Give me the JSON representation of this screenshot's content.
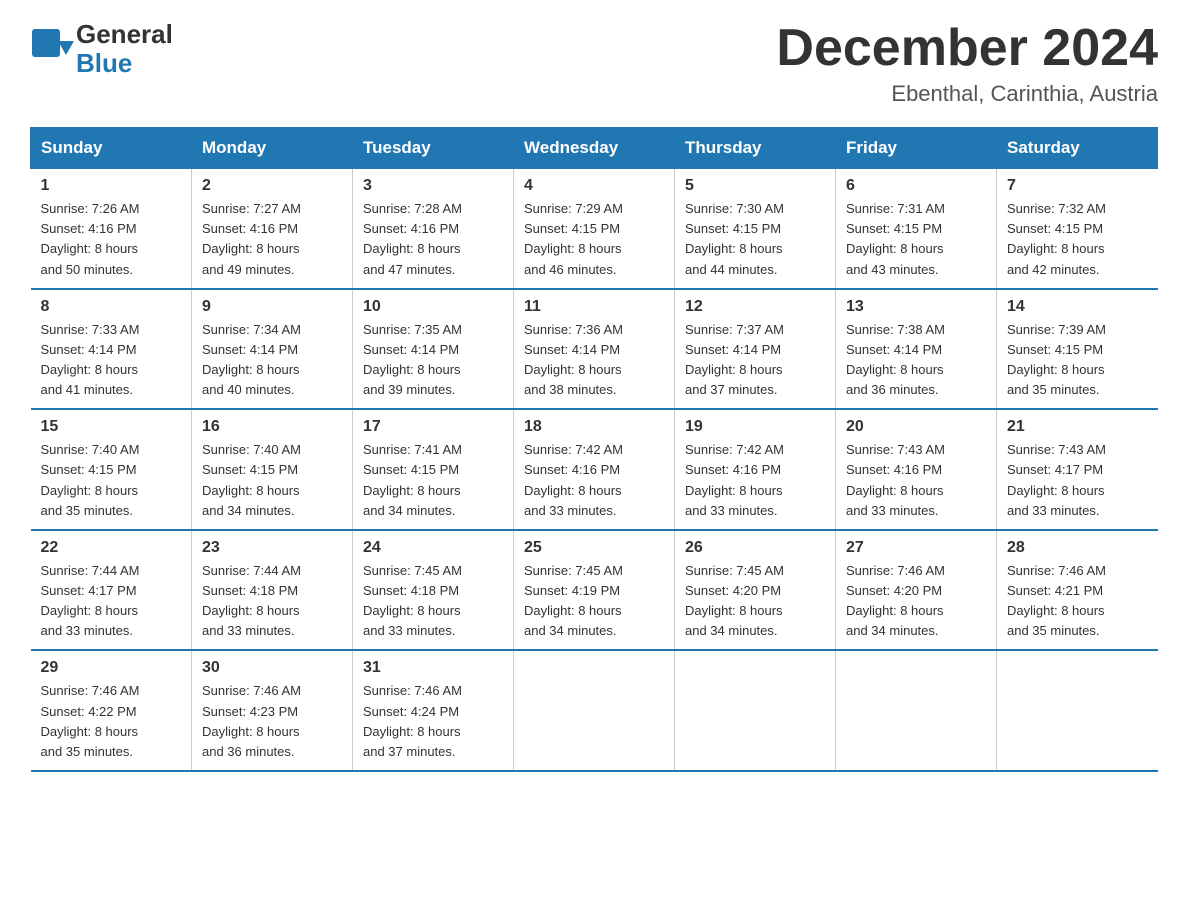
{
  "header": {
    "logo_general": "General",
    "logo_blue": "Blue",
    "month_title": "December 2024",
    "location": "Ebenthal, Carinthia, Austria"
  },
  "weekdays": [
    "Sunday",
    "Monday",
    "Tuesday",
    "Wednesday",
    "Thursday",
    "Friday",
    "Saturday"
  ],
  "weeks": [
    [
      {
        "day": "1",
        "sunrise": "7:26 AM",
        "sunset": "4:16 PM",
        "daylight": "8 hours and 50 minutes."
      },
      {
        "day": "2",
        "sunrise": "7:27 AM",
        "sunset": "4:16 PM",
        "daylight": "8 hours and 49 minutes."
      },
      {
        "day": "3",
        "sunrise": "7:28 AM",
        "sunset": "4:16 PM",
        "daylight": "8 hours and 47 minutes."
      },
      {
        "day": "4",
        "sunrise": "7:29 AM",
        "sunset": "4:15 PM",
        "daylight": "8 hours and 46 minutes."
      },
      {
        "day": "5",
        "sunrise": "7:30 AM",
        "sunset": "4:15 PM",
        "daylight": "8 hours and 44 minutes."
      },
      {
        "day": "6",
        "sunrise": "7:31 AM",
        "sunset": "4:15 PM",
        "daylight": "8 hours and 43 minutes."
      },
      {
        "day": "7",
        "sunrise": "7:32 AM",
        "sunset": "4:15 PM",
        "daylight": "8 hours and 42 minutes."
      }
    ],
    [
      {
        "day": "8",
        "sunrise": "7:33 AM",
        "sunset": "4:14 PM",
        "daylight": "8 hours and 41 minutes."
      },
      {
        "day": "9",
        "sunrise": "7:34 AM",
        "sunset": "4:14 PM",
        "daylight": "8 hours and 40 minutes."
      },
      {
        "day": "10",
        "sunrise": "7:35 AM",
        "sunset": "4:14 PM",
        "daylight": "8 hours and 39 minutes."
      },
      {
        "day": "11",
        "sunrise": "7:36 AM",
        "sunset": "4:14 PM",
        "daylight": "8 hours and 38 minutes."
      },
      {
        "day": "12",
        "sunrise": "7:37 AM",
        "sunset": "4:14 PM",
        "daylight": "8 hours and 37 minutes."
      },
      {
        "day": "13",
        "sunrise": "7:38 AM",
        "sunset": "4:14 PM",
        "daylight": "8 hours and 36 minutes."
      },
      {
        "day": "14",
        "sunrise": "7:39 AM",
        "sunset": "4:15 PM",
        "daylight": "8 hours and 35 minutes."
      }
    ],
    [
      {
        "day": "15",
        "sunrise": "7:40 AM",
        "sunset": "4:15 PM",
        "daylight": "8 hours and 35 minutes."
      },
      {
        "day": "16",
        "sunrise": "7:40 AM",
        "sunset": "4:15 PM",
        "daylight": "8 hours and 34 minutes."
      },
      {
        "day": "17",
        "sunrise": "7:41 AM",
        "sunset": "4:15 PM",
        "daylight": "8 hours and 34 minutes."
      },
      {
        "day": "18",
        "sunrise": "7:42 AM",
        "sunset": "4:16 PM",
        "daylight": "8 hours and 33 minutes."
      },
      {
        "day": "19",
        "sunrise": "7:42 AM",
        "sunset": "4:16 PM",
        "daylight": "8 hours and 33 minutes."
      },
      {
        "day": "20",
        "sunrise": "7:43 AM",
        "sunset": "4:16 PM",
        "daylight": "8 hours and 33 minutes."
      },
      {
        "day": "21",
        "sunrise": "7:43 AM",
        "sunset": "4:17 PM",
        "daylight": "8 hours and 33 minutes."
      }
    ],
    [
      {
        "day": "22",
        "sunrise": "7:44 AM",
        "sunset": "4:17 PM",
        "daylight": "8 hours and 33 minutes."
      },
      {
        "day": "23",
        "sunrise": "7:44 AM",
        "sunset": "4:18 PM",
        "daylight": "8 hours and 33 minutes."
      },
      {
        "day": "24",
        "sunrise": "7:45 AM",
        "sunset": "4:18 PM",
        "daylight": "8 hours and 33 minutes."
      },
      {
        "day": "25",
        "sunrise": "7:45 AM",
        "sunset": "4:19 PM",
        "daylight": "8 hours and 34 minutes."
      },
      {
        "day": "26",
        "sunrise": "7:45 AM",
        "sunset": "4:20 PM",
        "daylight": "8 hours and 34 minutes."
      },
      {
        "day": "27",
        "sunrise": "7:46 AM",
        "sunset": "4:20 PM",
        "daylight": "8 hours and 34 minutes."
      },
      {
        "day": "28",
        "sunrise": "7:46 AM",
        "sunset": "4:21 PM",
        "daylight": "8 hours and 35 minutes."
      }
    ],
    [
      {
        "day": "29",
        "sunrise": "7:46 AM",
        "sunset": "4:22 PM",
        "daylight": "8 hours and 35 minutes."
      },
      {
        "day": "30",
        "sunrise": "7:46 AM",
        "sunset": "4:23 PM",
        "daylight": "8 hours and 36 minutes."
      },
      {
        "day": "31",
        "sunrise": "7:46 AM",
        "sunset": "4:24 PM",
        "daylight": "8 hours and 37 minutes."
      },
      {
        "day": "",
        "sunrise": "",
        "sunset": "",
        "daylight": ""
      },
      {
        "day": "",
        "sunrise": "",
        "sunset": "",
        "daylight": ""
      },
      {
        "day": "",
        "sunrise": "",
        "sunset": "",
        "daylight": ""
      },
      {
        "day": "",
        "sunrise": "",
        "sunset": "",
        "daylight": ""
      }
    ]
  ],
  "labels": {
    "sunrise": "Sunrise: ",
    "sunset": "Sunset: ",
    "daylight": "Daylight: "
  }
}
